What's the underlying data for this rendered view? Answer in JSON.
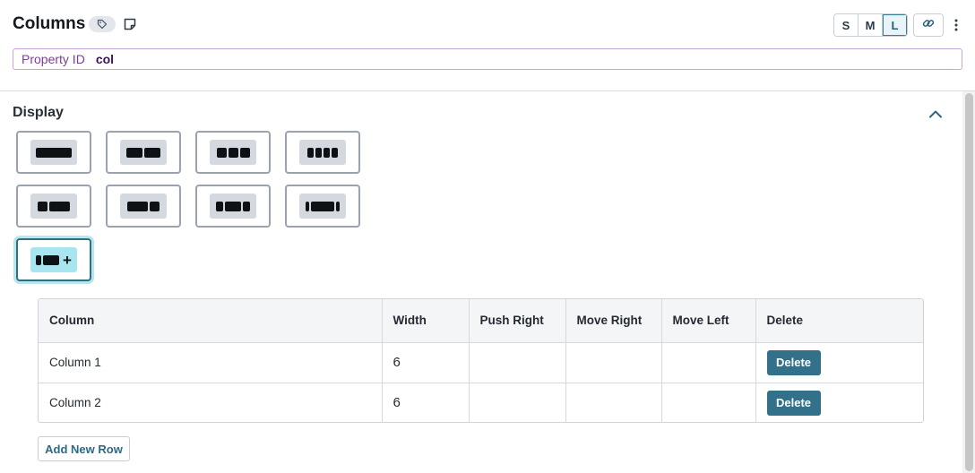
{
  "header": {
    "title": "Columns",
    "size_buttons": [
      {
        "label": "S",
        "active": false
      },
      {
        "label": "M",
        "active": false
      },
      {
        "label": "L",
        "active": true
      }
    ]
  },
  "property": {
    "label": "Property ID",
    "value": "col"
  },
  "display": {
    "title": "Display",
    "layout_options": [
      {
        "name": "one-column",
        "segments": [
          40
        ]
      },
      {
        "name": "two-equal",
        "segments": [
          18,
          18
        ]
      },
      {
        "name": "three-equal",
        "segments": [
          11,
          11,
          11
        ]
      },
      {
        "name": "four-equal",
        "segments": [
          7,
          7,
          7,
          7
        ]
      },
      {
        "name": "one-third-two-thirds",
        "segments": [
          11,
          23
        ]
      },
      {
        "name": "two-thirds-one-third",
        "segments": [
          23,
          11
        ]
      },
      {
        "name": "quarter-half-quarter",
        "segments": [
          8,
          18,
          8
        ]
      },
      {
        "name": "narrow-wide-narrow",
        "segments": [
          4,
          26,
          4
        ]
      },
      {
        "name": "custom",
        "segments": [
          6,
          18
        ],
        "plus": true,
        "selected": true
      }
    ]
  },
  "table": {
    "headers": [
      "Column",
      "Width",
      "Push Right",
      "Move Right",
      "Move Left",
      "Delete"
    ],
    "rows": [
      {
        "column": "Column 1",
        "width": "6",
        "push_right": "",
        "move_right": "",
        "move_left": "",
        "delete_label": "Delete"
      },
      {
        "column": "Column 2",
        "width": "6",
        "push_right": "",
        "move_right": "",
        "move_left": "",
        "delete_label": "Delete"
      }
    ]
  },
  "add_row_label": "Add New Row",
  "icons": {
    "tag": "tag-icon",
    "note": "note-icon",
    "link": "link-icon",
    "more": "more-vertical-icon",
    "collapse": "chevron-up-icon"
  },
  "colors": {
    "accent": "#33708a",
    "selected_glow": "#b9e6ee",
    "property_label": "#7a3f93"
  }
}
